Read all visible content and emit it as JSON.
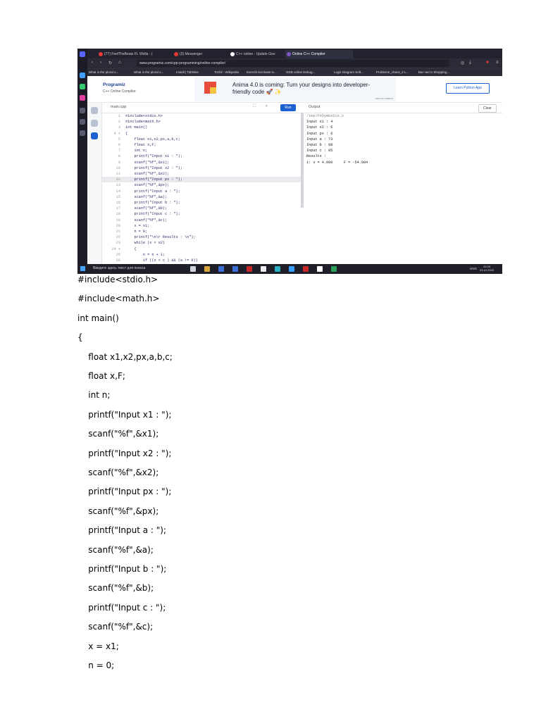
{
  "browser": {
    "tabs": [
      {
        "label": "(77) FeelTheBeats Ft. Wella - (",
        "color": "#e53935"
      },
      {
        "label": "(3) Messenger",
        "color": "#e53935"
      },
      {
        "label": "C++ online - Update Goo",
        "color": "#ffffff"
      },
      {
        "label": "Online C++ Compiler",
        "color": "#7e57c2",
        "active": true
      }
    ],
    "url": "www.programiz.com/cpp-programming/online-compiler/",
    "bookmarks": [
      "What is the plural o...",
      "What is the plural o...",
      "Install | TabNine",
      "Tochil - Wikipedia",
      "Exerciti rezolvate in...",
      "GDB online Debug...",
      "Logic Diagram Soft...",
      "Probleme_chaos_2 L...",
      "Bar-чисто Shopping..."
    ]
  },
  "site": {
    "logo": "Programiz",
    "subtitle": "C++ Online Compiler",
    "ad_text": "Anima 4.0 is coming: Turn your designs into developer-friendly code 🚀 ✨",
    "ad_small": "ADS VIA CARBON",
    "learn_button": "Learn Python App"
  },
  "editor": {
    "filename": "main.cpp",
    "run_label": "Run",
    "highlight_line": 12,
    "lines": [
      {
        "n": "1",
        "t": "#include<stdio.h>"
      },
      {
        "n": "2",
        "t": "#include<math.h>"
      },
      {
        "n": "3",
        "t": "int main()"
      },
      {
        "n": "4 ▾",
        "t": "{"
      },
      {
        "n": "5",
        "t": "    float x1,x2,px,a,b,c;"
      },
      {
        "n": "6",
        "t": "    float x,F;"
      },
      {
        "n": "7",
        "t": "    int n;"
      },
      {
        "n": "8",
        "t": "    printf(\"Input x1 : \");"
      },
      {
        "n": "9",
        "t": "    scanf(\"%f\",&x1);"
      },
      {
        "n": "10",
        "t": "    printf(\"Input x2 : \");"
      },
      {
        "n": "11",
        "t": "    scanf(\"%f\",&x2);"
      },
      {
        "n": "12",
        "t": "    printf(\"Input px : \");"
      },
      {
        "n": "13",
        "t": "    scanf(\"%f\",&px);"
      },
      {
        "n": "14",
        "t": "    printf(\"Input a : \");"
      },
      {
        "n": "15",
        "t": "    scanf(\"%f\",&a);"
      },
      {
        "n": "16",
        "t": "    printf(\"Input b : \");"
      },
      {
        "n": "17",
        "t": "    scanf(\"%f\",&b);"
      },
      {
        "n": "18",
        "t": "    printf(\"Input c : \");"
      },
      {
        "n": "19",
        "t": "    scanf(\"%f\",&c);"
      },
      {
        "n": "20",
        "t": "    x = x1;"
      },
      {
        "n": "21",
        "t": "    n = 0;"
      },
      {
        "n": "22",
        "t": "    printf(\"\\n\\r Results : \\n\");"
      },
      {
        "n": "23",
        "t": "    while (x < x2)"
      },
      {
        "n": "24 ▾",
        "t": "    {"
      },
      {
        "n": "25",
        "t": "        n = n + 1;"
      },
      {
        "n": "26",
        "t": "        if ((x < c ) && (a != 0))"
      }
    ]
  },
  "output": {
    "label": "Output",
    "clear_label": "Clear",
    "lines": [
      "/tmp/F4DymKA52A.o",
      "Input x1 : 4",
      "Input x2 : 5",
      "Input px : 6",
      "Input a : 73",
      "Input b : 98",
      "Input c : 85",
      "Results :",
      "1: x = 4.000     F = -54.084"
    ]
  },
  "taskbar": {
    "search_placeholder": "Введите здесь текст для поиска",
    "lang": "ENG",
    "time": "20:25",
    "date": "23.10.2020"
  },
  "document": {
    "lines": [
      "#include<stdio.h>",
      "#include<math.h>",
      "int main()",
      "{",
      "    float x1,x2,px,a,b,c;",
      "    float x,F;",
      "    int n;",
      "    printf(\"Input x1 : \");",
      "    scanf(\"%f\",&x1);",
      "    printf(\"Input x2 : \");",
      "    scanf(\"%f\",&x2);",
      "    printf(\"Input px : \");",
      "    scanf(\"%f\",&px);",
      "    printf(\"Input a : \");",
      "    scanf(\"%f\",&a);",
      "    printf(\"Input b : \");",
      "    scanf(\"%f\",&b);",
      "    printf(\"Input c : \");",
      "    scanf(\"%f\",&c);",
      "    x = x1;",
      "    n = 0;"
    ]
  }
}
